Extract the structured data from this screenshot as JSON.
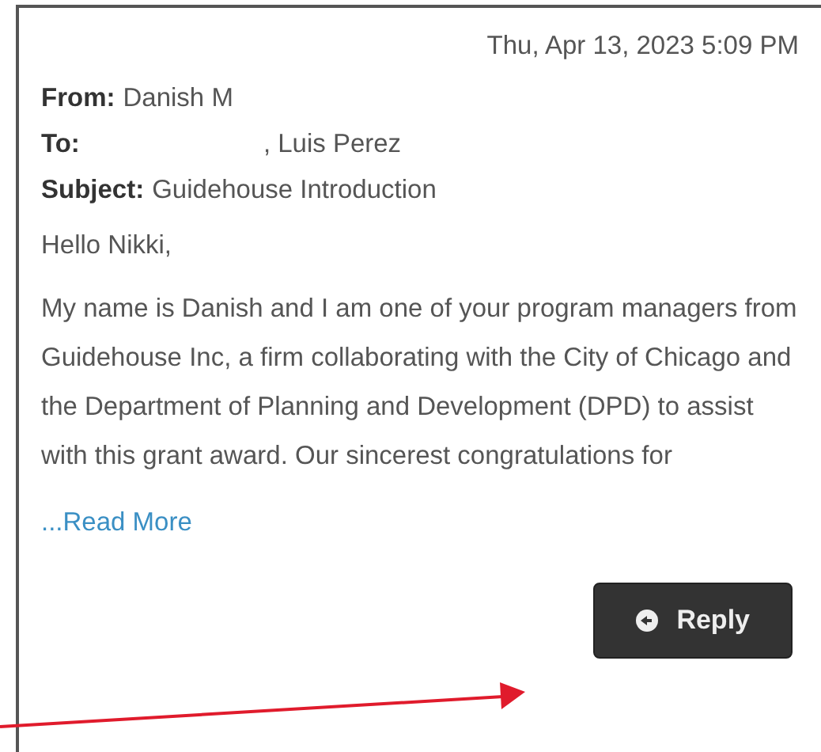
{
  "date": "Thu, Apr 13, 2023 5:09 PM",
  "headers": [
    {
      "label": "From:",
      "value": "Danish M"
    },
    {
      "label": "To:",
      "value": ", Luis Perez",
      "redacted": true
    },
    {
      "label": "Subject:",
      "value": "Guidehouse Introduction"
    }
  ],
  "greeting": "Hello Nikki,",
  "body": "My name is Danish and I am one of your program managers from Guidehouse Inc, a firm collaborating with the City of Chicago and the Department of Planning and Development (DPD) to assist with this grant award. Our sincerest congratulations for",
  "read_more": "...Read More",
  "reply_button": "Reply"
}
